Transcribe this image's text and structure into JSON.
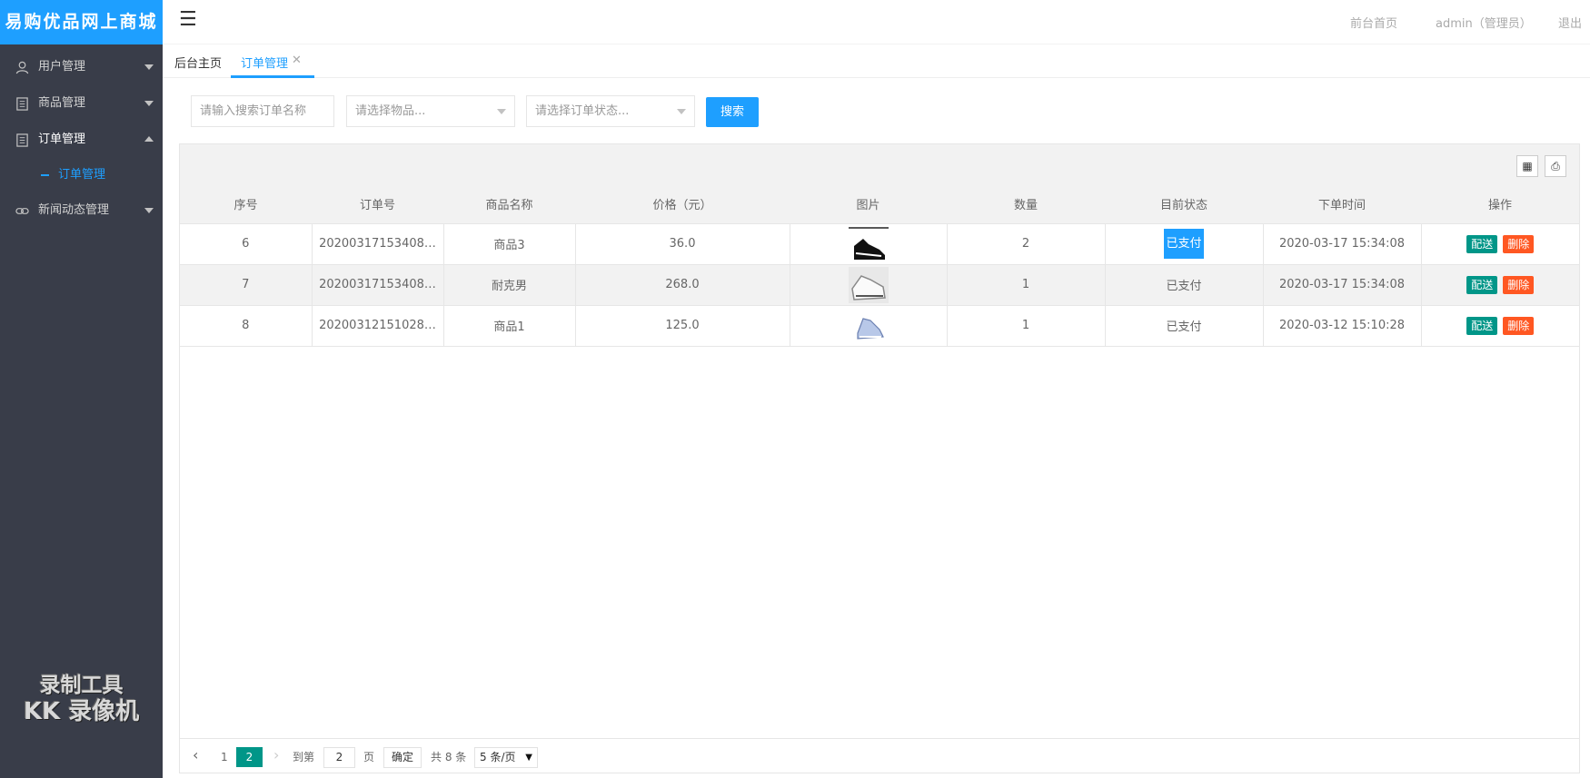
{
  "app": {
    "logo": "易购优品网上商城"
  },
  "header": {
    "home": "前台首页",
    "user": "admin（管理员）",
    "logout": "退出"
  },
  "sidebar": {
    "items": [
      {
        "label": "用户管理"
      },
      {
        "label": "商品管理"
      },
      {
        "label": "订单管理"
      },
      {
        "label": "新闻动态管理"
      }
    ],
    "sub_item": "订单管理"
  },
  "watermark": {
    "line1": "录制工具",
    "line2": "KK 录像机"
  },
  "tabs": [
    {
      "label": "后台主页"
    },
    {
      "label": "订单管理"
    }
  ],
  "filters": {
    "search_placeholder": "请输入搜索订单名称",
    "goods_placeholder": "请选择物品...",
    "status_placeholder": "请选择订单状态...",
    "search_button": "搜索"
  },
  "table": {
    "columns": [
      "序号",
      "订单号",
      "商品名称",
      "价格（元）",
      "图片",
      "数量",
      "目前状态",
      "下单时间",
      "操作"
    ],
    "rows": [
      {
        "id": "6",
        "order_no": "20200317153408…",
        "name": "商品3",
        "price": "36.0",
        "qty": "2",
        "status": "已支付",
        "time": "2020-03-17 15:34:08"
      },
      {
        "id": "7",
        "order_no": "20200317153408…",
        "name": "耐克男",
        "price": "268.0",
        "qty": "1",
        "status": "已支付",
        "time": "2020-03-17 15:34:08"
      },
      {
        "id": "8",
        "order_no": "20200312151028…",
        "name": "商品1",
        "price": "125.0",
        "qty": "1",
        "status": "已支付",
        "time": "2020-03-12 15:10:28"
      }
    ],
    "actions": {
      "deliver": "配送",
      "delete": "删除"
    }
  },
  "pager": {
    "prev": "‹",
    "page1": "1",
    "current": "2",
    "next": "›",
    "goto_label": "到第",
    "goto_value": "2",
    "page_unit": "页",
    "confirm": "确定",
    "total": "共 8 条",
    "page_size": "5 条/页"
  },
  "colors": {
    "accent": "#1e9fff",
    "sidebar": "#393d49",
    "deliver": "#009688",
    "delete": "#ff5722"
  }
}
